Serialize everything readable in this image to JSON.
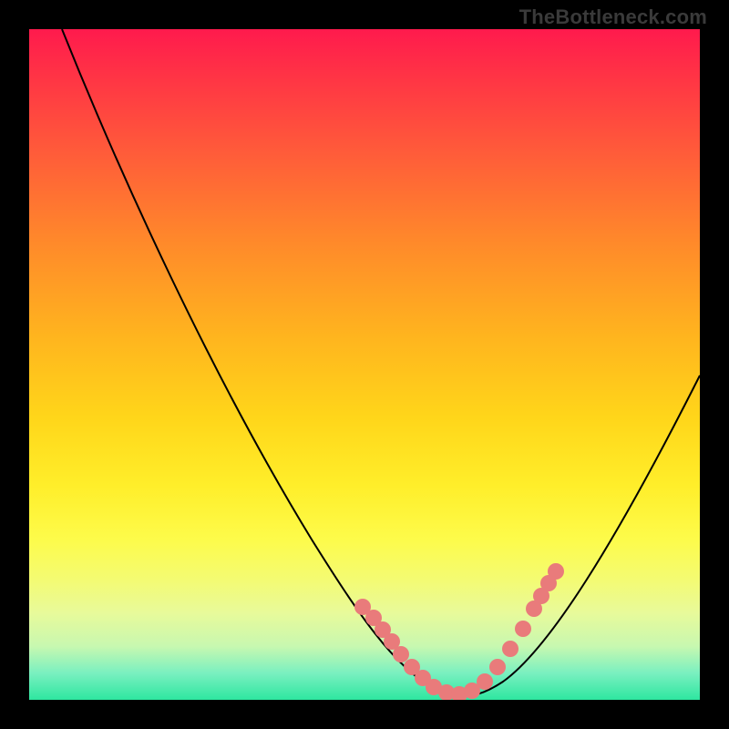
{
  "attribution": "TheBottleneck.com",
  "colors": {
    "frame": "#000000",
    "gradient_top": "#ff1a4d",
    "gradient_mid": "#ffd61a",
    "gradient_bottom": "#2ee6a0",
    "curve": "#000000",
    "dots": "#e97b7b"
  },
  "chart_data": {
    "type": "line",
    "title": "",
    "xlabel": "",
    "ylabel": "",
    "xlim": [
      0,
      100
    ],
    "ylim": [
      0,
      100
    ],
    "note": "No axis tick labels are shown; values are estimated from the curve geometry relative to the plot frame (0–100 each axis).",
    "series": [
      {
        "name": "curve",
        "x": [
          5,
          10,
          15,
          20,
          25,
          30,
          35,
          40,
          45,
          50,
          55,
          60,
          63,
          66,
          70,
          75,
          80,
          85,
          90,
          95,
          100
        ],
        "values": [
          100,
          92,
          83,
          74,
          64,
          54,
          44,
          34,
          24,
          15,
          8,
          3,
          1,
          1,
          3,
          8,
          15,
          24,
          33,
          42,
          50
        ]
      }
    ],
    "highlighted_points": {
      "name": "pink-dots",
      "x": [
        50,
        51.5,
        53,
        54.5,
        56,
        58,
        60,
        62,
        63.5,
        64.5,
        66,
        68,
        70,
        72,
        74,
        76,
        77,
        78,
        79
      ],
      "values": [
        14,
        12.5,
        11,
        9.5,
        7.5,
        5.5,
        3.5,
        2,
        1.2,
        1,
        1.5,
        3,
        5,
        8,
        11,
        14,
        15.5,
        17,
        18.5
      ]
    }
  }
}
